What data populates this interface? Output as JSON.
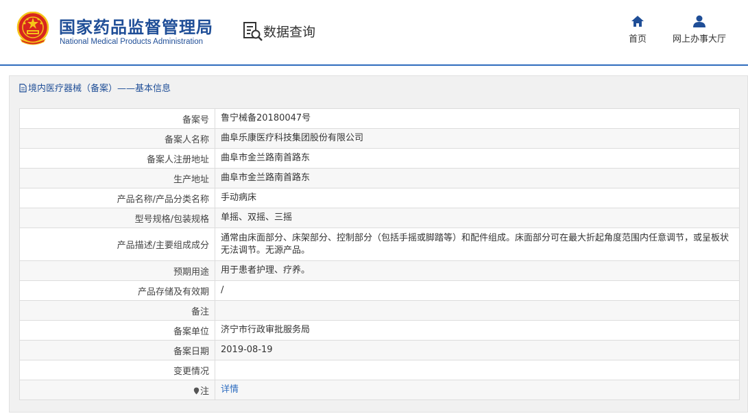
{
  "header": {
    "brand_cn": "国家药品监督管理局",
    "brand_en": "National Medical Products Administration",
    "search_title": "数据查询",
    "nav": [
      {
        "label": "首页",
        "icon": "home-icon"
      },
      {
        "label": "网上办事大厅",
        "icon": "user-icon"
      }
    ]
  },
  "panel": {
    "title": "境内医疗器械（备案）——基本信息",
    "rows": [
      {
        "label": "备案号",
        "value": "鲁宁械备20180047号"
      },
      {
        "label": "备案人名称",
        "value": "曲阜乐康医疗科技集团股份有限公司"
      },
      {
        "label": "备案人注册地址",
        "value": "曲阜市金兰路南首路东"
      },
      {
        "label": "生产地址",
        "value": "曲阜市金兰路南首路东"
      },
      {
        "label": "产品名称/产品分类名称",
        "value": "手动病床"
      },
      {
        "label": "型号规格/包装规格",
        "value": "单摇、双摇、三摇"
      },
      {
        "label": "产品描述/主要组成成分",
        "value": "通常由床面部分、床架部分、控制部分（包括手摇或脚踏等）和配件组成。床面部分可在最大折起角度范围内任意调节，或呈板状无法调节。无源产品。"
      },
      {
        "label": "预期用途",
        "value": "用于患者护理、疗养。"
      },
      {
        "label": "产品存储及有效期",
        "value": "/"
      },
      {
        "label": "备注",
        "value": ""
      },
      {
        "label": "备案单位",
        "value": "济宁市行政审批服务局"
      },
      {
        "label": "备案日期",
        "value": "2019-08-19"
      },
      {
        "label": "变更情况",
        "value": ""
      },
      {
        "label": "注",
        "value": "详情"
      }
    ]
  },
  "colors": {
    "brand_blue": "#1f4e97",
    "link_blue": "#2e6dc0",
    "emblem_red": "#d7261e",
    "emblem_gold": "#f5c518"
  }
}
